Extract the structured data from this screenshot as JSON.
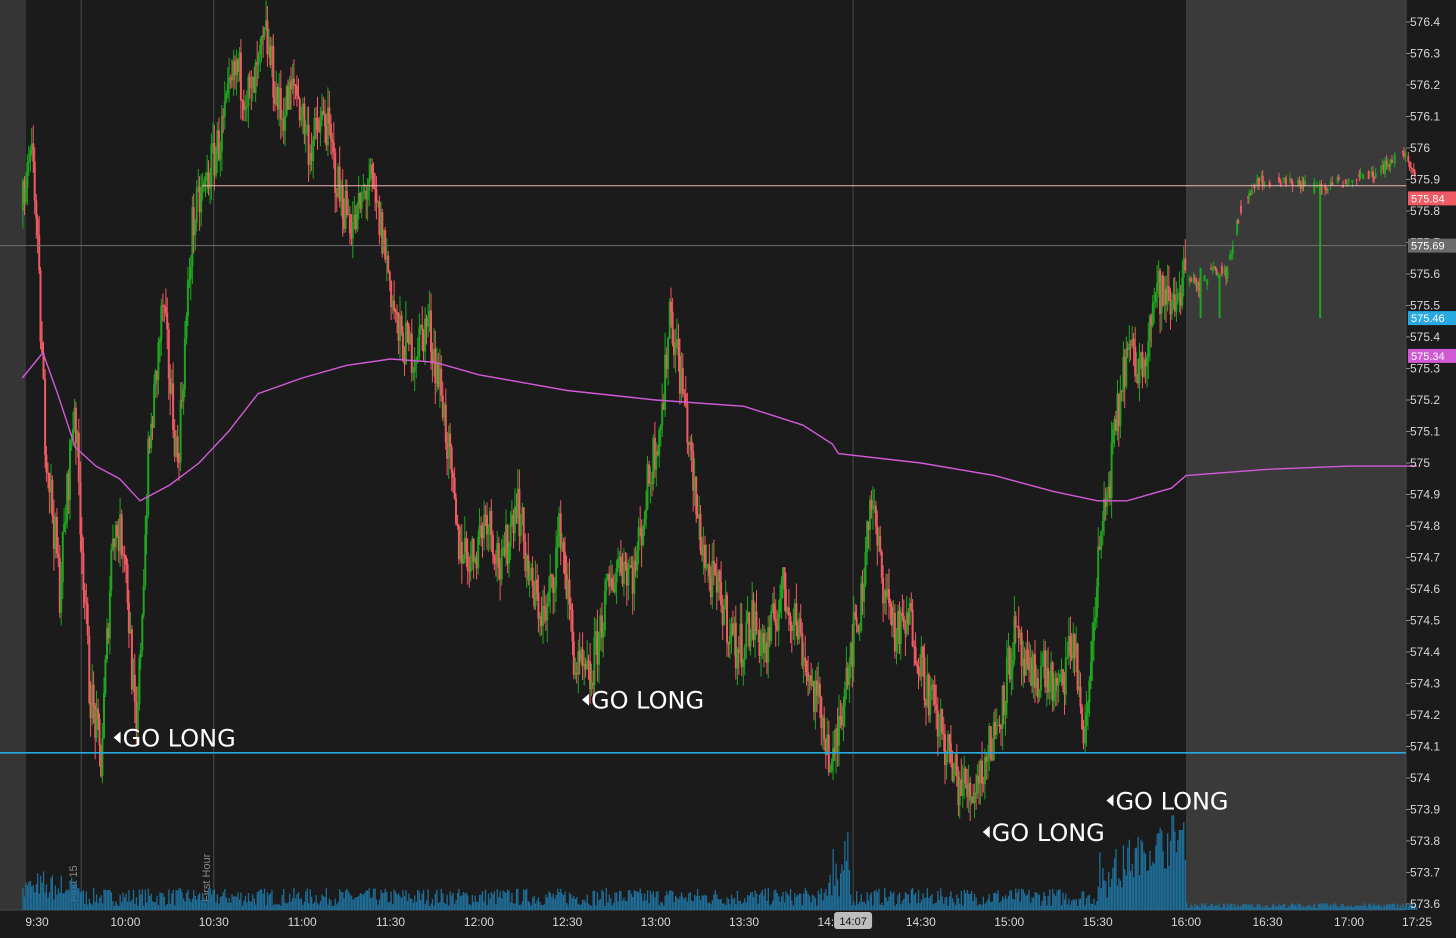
{
  "chart_data": {
    "type": "candlestick",
    "session_times": [
      "9:30",
      "10:00",
      "10:30",
      "11:00",
      "11:30",
      "12:00",
      "12:30",
      "13:00",
      "13:30",
      "14:00",
      "14:30",
      "15:00",
      "15:30",
      "16:00",
      "16:30",
      "17:00",
      "17:25"
    ],
    "time_range": [
      "9:25",
      "17:25"
    ],
    "regular_session_end": "16:00",
    "ylim": [
      573.57,
      576.47
    ],
    "y_ticks": [
      576.4,
      576.3,
      576.2,
      576.1,
      576,
      575.9,
      575.8,
      575.7,
      575.6,
      575.5,
      575.4,
      575.3,
      575.2,
      575.1,
      575,
      574.9,
      574.8,
      574.7,
      574.6,
      574.5,
      574.4,
      574.3,
      574.2,
      574.1,
      574,
      573.9,
      573.8,
      573.7,
      573.6
    ],
    "y_tick_labels": [
      "576.4",
      "576.3",
      "576.2",
      "576.1",
      "576",
      "575.9",
      "575.8",
      "575.7",
      "575.6",
      "575.5",
      "575.4",
      "575.3",
      "575.2",
      "575.1",
      "575",
      "574.9",
      "574.8",
      "574.7",
      "574.6",
      "574.5",
      "574.4",
      "574.3",
      "574.2",
      "574.1",
      "574",
      "573.9",
      "573.8",
      "573.7",
      "573.6"
    ],
    "up_color": "#1fa51f",
    "down_color": "#f05a63",
    "vwap_color": "#d25ad7",
    "price_path": [
      {
        "t": "9:25",
        "v": 575.8
      },
      {
        "t": "9:29",
        "v": 575.98
      },
      {
        "t": "9:33",
        "v": 575.1
      },
      {
        "t": "9:38",
        "v": 574.6
      },
      {
        "t": "9:43",
        "v": 575.2
      },
      {
        "t": "9:48",
        "v": 574.3
      },
      {
        "t": "9:52",
        "v": 574.05
      },
      {
        "t": "9:56",
        "v": 574.8
      },
      {
        "t": "10:00",
        "v": 574.75
      },
      {
        "t": "10:04",
        "v": 574.1
      },
      {
        "t": "10:08",
        "v": 575.0
      },
      {
        "t": "10:13",
        "v": 575.5
      },
      {
        "t": "10:18",
        "v": 575.0
      },
      {
        "t": "10:23",
        "v": 575.75
      },
      {
        "t": "10:28",
        "v": 575.9
      },
      {
        "t": "10:33",
        "v": 576.05
      },
      {
        "t": "10:38",
        "v": 576.25
      },
      {
        "t": "10:43",
        "v": 576.15
      },
      {
        "t": "10:48",
        "v": 576.35
      },
      {
        "t": "10:53",
        "v": 576.1
      },
      {
        "t": "10:58",
        "v": 576.2
      },
      {
        "t": "11:03",
        "v": 576.0
      },
      {
        "t": "11:08",
        "v": 576.1
      },
      {
        "t": "11:13",
        "v": 575.85
      },
      {
        "t": "11:18",
        "v": 575.75
      },
      {
        "t": "11:23",
        "v": 575.9
      },
      {
        "t": "11:28",
        "v": 575.7
      },
      {
        "t": "11:33",
        "v": 575.4
      },
      {
        "t": "11:38",
        "v": 575.35
      },
      {
        "t": "11:43",
        "v": 575.45
      },
      {
        "t": "11:48",
        "v": 575.2
      },
      {
        "t": "11:53",
        "v": 574.75
      },
      {
        "t": "11:58",
        "v": 574.7
      },
      {
        "t": "12:03",
        "v": 574.85
      },
      {
        "t": "12:08",
        "v": 574.65
      },
      {
        "t": "12:13",
        "v": 574.9
      },
      {
        "t": "12:18",
        "v": 574.6
      },
      {
        "t": "12:23",
        "v": 574.5
      },
      {
        "t": "12:28",
        "v": 574.8
      },
      {
        "t": "12:33",
        "v": 574.35
      },
      {
        "t": "12:38",
        "v": 574.3
      },
      {
        "t": "12:43",
        "v": 574.55
      },
      {
        "t": "12:48",
        "v": 574.7
      },
      {
        "t": "12:53",
        "v": 574.65
      },
      {
        "t": "12:58",
        "v": 574.95
      },
      {
        "t": "13:03",
        "v": 575.2
      },
      {
        "t": "13:05",
        "v": 575.5
      },
      {
        "t": "13:10",
        "v": 575.2
      },
      {
        "t": "13:14",
        "v": 574.85
      },
      {
        "t": "13:18",
        "v": 574.65
      },
      {
        "t": "13:23",
        "v": 574.55
      },
      {
        "t": "13:28",
        "v": 574.4
      },
      {
        "t": "13:33",
        "v": 574.5
      },
      {
        "t": "13:38",
        "v": 574.4
      },
      {
        "t": "13:43",
        "v": 574.6
      },
      {
        "t": "13:48",
        "v": 574.5
      },
      {
        "t": "13:53",
        "v": 574.3
      },
      {
        "t": "13:58",
        "v": 574.15
      },
      {
        "t": "14:00",
        "v": 574.0
      },
      {
        "t": "14:05",
        "v": 574.35
      },
      {
        "t": "14:10",
        "v": 574.55
      },
      {
        "t": "14:13",
        "v": 574.9
      },
      {
        "t": "14:17",
        "v": 574.65
      },
      {
        "t": "14:22",
        "v": 574.45
      },
      {
        "t": "14:27",
        "v": 574.5
      },
      {
        "t": "14:32",
        "v": 574.3
      },
      {
        "t": "14:37",
        "v": 574.15
      },
      {
        "t": "14:42",
        "v": 574.0
      },
      {
        "t": "14:47",
        "v": 573.95
      },
      {
        "t": "14:52",
        "v": 574.05
      },
      {
        "t": "14:57",
        "v": 574.2
      },
      {
        "t": "15:02",
        "v": 574.45
      },
      {
        "t": "15:07",
        "v": 574.3
      },
      {
        "t": "15:12",
        "v": 574.35
      },
      {
        "t": "15:17",
        "v": 574.25
      },
      {
        "t": "15:22",
        "v": 574.45
      },
      {
        "t": "15:26",
        "v": 574.1
      },
      {
        "t": "15:30",
        "v": 574.65
      },
      {
        "t": "15:35",
        "v": 575.0
      },
      {
        "t": "15:40",
        "v": 575.35
      },
      {
        "t": "15:45",
        "v": 575.3
      },
      {
        "t": "15:50",
        "v": 575.55
      },
      {
        "t": "15:55",
        "v": 575.5
      },
      {
        "t": "16:00",
        "v": 575.6
      },
      {
        "t": "16:05",
        "v": 575.55
      },
      {
        "t": "16:10",
        "v": 575.62
      },
      {
        "t": "16:15",
        "v": 575.6
      },
      {
        "t": "16:20",
        "v": 575.8
      },
      {
        "t": "16:25",
        "v": 575.88
      },
      {
        "t": "16:30",
        "v": 575.9
      },
      {
        "t": "16:40",
        "v": 575.88
      },
      {
        "t": "16:50",
        "v": 575.87
      },
      {
        "t": "17:00",
        "v": 575.9
      },
      {
        "t": "17:10",
        "v": 575.91
      },
      {
        "t": "17:20",
        "v": 576.0
      },
      {
        "t": "17:25",
        "v": 575.9
      }
    ],
    "vwap_path": [
      {
        "t": "9:25",
        "v": 575.27
      },
      {
        "t": "9:32",
        "v": 575.35
      },
      {
        "t": "9:37",
        "v": 575.22
      },
      {
        "t": "9:43",
        "v": 575.05
      },
      {
        "t": "9:50",
        "v": 574.99
      },
      {
        "t": "9:58",
        "v": 574.95
      },
      {
        "t": "10:05",
        "v": 574.88
      },
      {
        "t": "10:15",
        "v": 574.93
      },
      {
        "t": "10:25",
        "v": 575.0
      },
      {
        "t": "10:35",
        "v": 575.1
      },
      {
        "t": "10:45",
        "v": 575.22
      },
      {
        "t": "11:00",
        "v": 575.27
      },
      {
        "t": "11:15",
        "v": 575.31
      },
      {
        "t": "11:30",
        "v": 575.33
      },
      {
        "t": "11:45",
        "v": 575.32
      },
      {
        "t": "12:00",
        "v": 575.28
      },
      {
        "t": "12:30",
        "v": 575.23
      },
      {
        "t": "13:00",
        "v": 575.2
      },
      {
        "t": "13:30",
        "v": 575.18
      },
      {
        "t": "13:50",
        "v": 575.12
      },
      {
        "t": "14:00",
        "v": 575.06
      },
      {
        "t": "14:02",
        "v": 575.03
      },
      {
        "t": "14:30",
        "v": 575.0
      },
      {
        "t": "14:55",
        "v": 574.96
      },
      {
        "t": "15:15",
        "v": 574.91
      },
      {
        "t": "15:30",
        "v": 574.88
      },
      {
        "t": "15:40",
        "v": 574.88
      },
      {
        "t": "15:55",
        "v": 574.92
      },
      {
        "t": "16:00",
        "v": 574.96
      },
      {
        "t": "16:30",
        "v": 574.98
      },
      {
        "t": "17:00",
        "v": 574.99
      },
      {
        "t": "17:25",
        "v": 574.99
      }
    ],
    "horizontal_lines": [
      {
        "value": 575.88,
        "color": "#f4b1b5"
      },
      {
        "value": 575.69,
        "color": "#6e6e6e"
      },
      {
        "value": 574.08,
        "color": "#29a9e0"
      }
    ],
    "price_tags": [
      {
        "value": 575.84,
        "label": "575.84",
        "bg": "#f05a63",
        "fg": "#ffffff"
      },
      {
        "value": 575.69,
        "label": "575.69",
        "bg": "#6b6b6b",
        "fg": "#ffffff"
      },
      {
        "value": 575.46,
        "label": "575.46",
        "bg": "#29a9e0",
        "fg": "#ffffff"
      },
      {
        "value": 575.34,
        "label": "575.34",
        "bg": "#d25ad7",
        "fg": "#ffffff"
      }
    ],
    "annotations": [
      {
        "t": "9:56",
        "v": 574.1,
        "text": "GO LONG"
      },
      {
        "t": "12:35",
        "v": 574.22,
        "text": "GO LONG"
      },
      {
        "t": "14:51",
        "v": 573.8,
        "text": "GO LONG"
      },
      {
        "t": "15:33",
        "v": 573.9,
        "text": "GO LONG"
      }
    ],
    "vertical_markers": [
      {
        "t": "9:45",
        "label": "First 15"
      },
      {
        "t": "10:30",
        "label": "First Hour"
      },
      {
        "t": "14:07",
        "label": ""
      }
    ],
    "crosshair_time_label": "14:07"
  }
}
